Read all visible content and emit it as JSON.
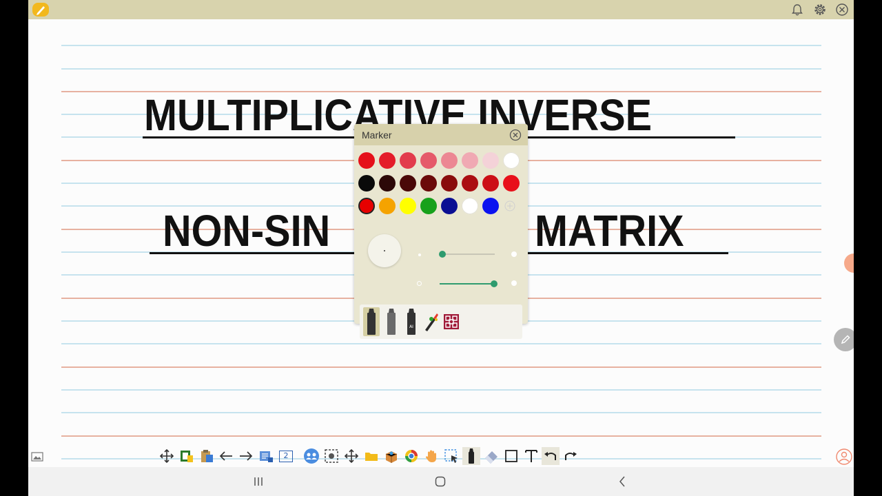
{
  "page": {
    "title_line1": "MULTIPLICATIVE INVERSE",
    "title_line2_left": "NON-SIN",
    "title_line2_right": "MATRIX"
  },
  "page_indicator": "2",
  "marker_panel": {
    "title": "Marker",
    "colors_row1": [
      "#e5101a",
      "#e41d2a",
      "#e23c4c",
      "#e55a6a",
      "#ec8793",
      "#f0a9b3",
      "#f4d2d8",
      "#ffffff"
    ],
    "colors_row2": [
      "#0a0a0a",
      "#2c0808",
      "#4a0808",
      "#6b0a0a",
      "#890c0c",
      "#ab0e12",
      "#cc0f16",
      "#e8101a"
    ],
    "colors_row3": [
      "#e60000",
      "#f5a300",
      "#ffff00",
      "#17a11b",
      "#0b0f93",
      "#ffffff",
      "#0b12f0"
    ],
    "selected_color": "#e60000",
    "size_level": 0.05,
    "opacity_level": 0.99,
    "tools": [
      "pen-tool",
      "marker-tool",
      "ai-pen-tool",
      "magic-pen-tool",
      "pattern-tool"
    ]
  },
  "colors": {
    "topbar": "#d8d3ad",
    "rule_blue": "#c6e3ee",
    "rule_red": "#e7b1a0",
    "accent_green": "#2e9b6e"
  }
}
